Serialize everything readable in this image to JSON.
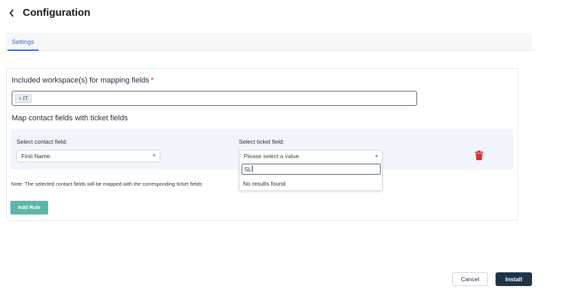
{
  "header": {
    "title": "Configuration",
    "back_icon": "chevron-left-icon"
  },
  "tabs": [
    {
      "label": "Settings",
      "active": true
    }
  ],
  "workspaces": {
    "label": "Included workspace(s) for mapping fields",
    "required_mark": "*",
    "chips": [
      {
        "remove": "×",
        "label": "IT"
      }
    ]
  },
  "mapping": {
    "section_label": "Map contact fields with ticket fields",
    "contact_field_label": "Select contact field:",
    "contact_field_value": "First Name",
    "ticket_field_label": "Select ticket field:",
    "ticket_field_placeholder": "Please select a value",
    "dropdown_search_value": "SL",
    "dropdown_empty_text": "No results found",
    "delete_icon": "trash-icon"
  },
  "note": "Note: The selected contact fields will be mapped with the corresponding ticket fields",
  "add_rule_label": "Add Rule",
  "footer": {
    "cancel_label": "Cancel",
    "install_label": "Install"
  },
  "colors": {
    "tab_accent": "#3f5bd9",
    "add_rule_bg": "#5bb8a9",
    "install_bg": "#1f3448",
    "delete_red": "#d9302d",
    "required_red": "#d72d2d"
  }
}
